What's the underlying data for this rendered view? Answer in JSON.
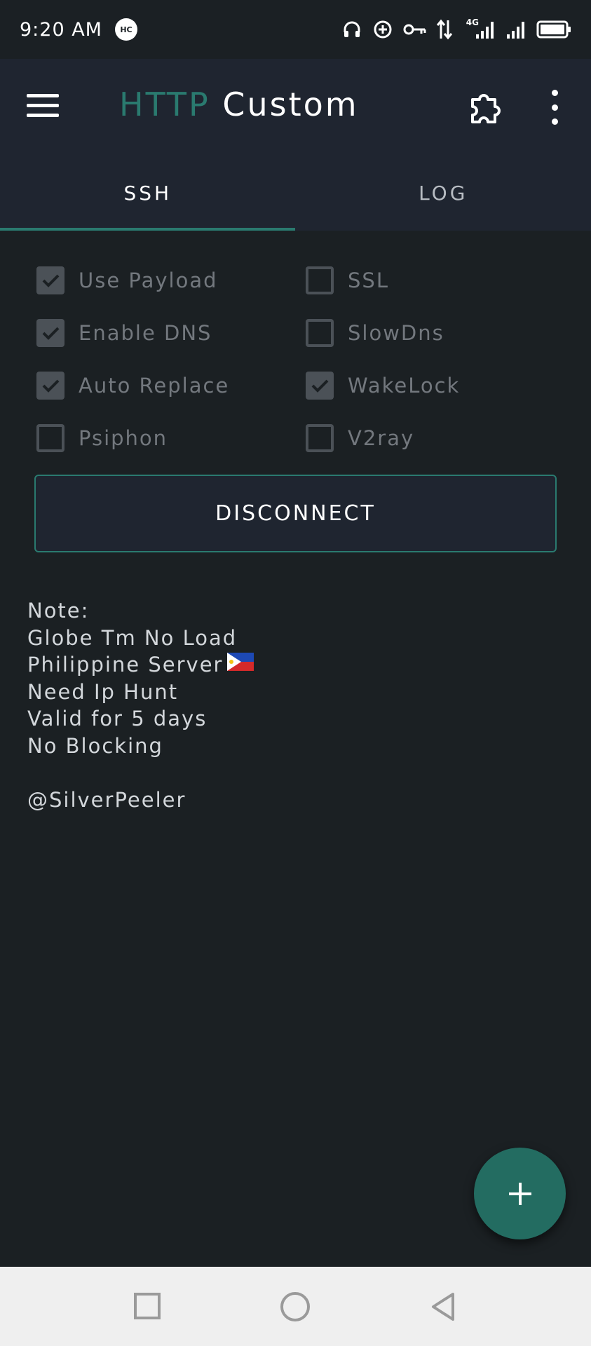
{
  "status_bar": {
    "time": "9:20 AM",
    "badge": "HC",
    "network": "4G",
    "icons": [
      "headset-icon",
      "data-saver-icon",
      "vpn-key-icon",
      "data-arrows-icon",
      "signal-icon",
      "signal-icon-2",
      "battery-icon"
    ]
  },
  "toolbar": {
    "title_part1": "HTTP",
    "title_part2": "Custom",
    "menu_icon": "hamburger-menu-icon",
    "plugin_icon": "puzzle-icon",
    "more_icon": "more-vertical-icon"
  },
  "tabs": [
    {
      "label": "SSH",
      "active": true
    },
    {
      "label": "LOG",
      "active": false
    }
  ],
  "options": [
    {
      "label": "Use Payload",
      "checked": true
    },
    {
      "label": "SSL",
      "checked": false
    },
    {
      "label": "Enable DNS",
      "checked": true
    },
    {
      "label": "SlowDns",
      "checked": false
    },
    {
      "label": "Auto Replace",
      "checked": true
    },
    {
      "label": "WakeLock",
      "checked": true
    },
    {
      "label": "Psiphon",
      "checked": false
    },
    {
      "label": "V2ray",
      "checked": false
    }
  ],
  "button": {
    "label": "DISCONNECT"
  },
  "note": {
    "lines": [
      "Note:",
      "Globe Tm No Load",
      "Philippine Server",
      "Need Ip Hunt",
      "Valid for 5 days",
      "No Blocking",
      "",
      "@SilverPeeler"
    ],
    "flag_icon": "philippine-flag-icon"
  },
  "fab": {
    "icon": "plus-icon"
  },
  "nav": {
    "icons": [
      "recents-square-icon",
      "home-circle-icon",
      "back-triangle-icon"
    ]
  },
  "colors": {
    "accent": "#2a7a6f",
    "background": "#1b2023",
    "toolbar": "#1f2530",
    "fab": "#236c61"
  }
}
